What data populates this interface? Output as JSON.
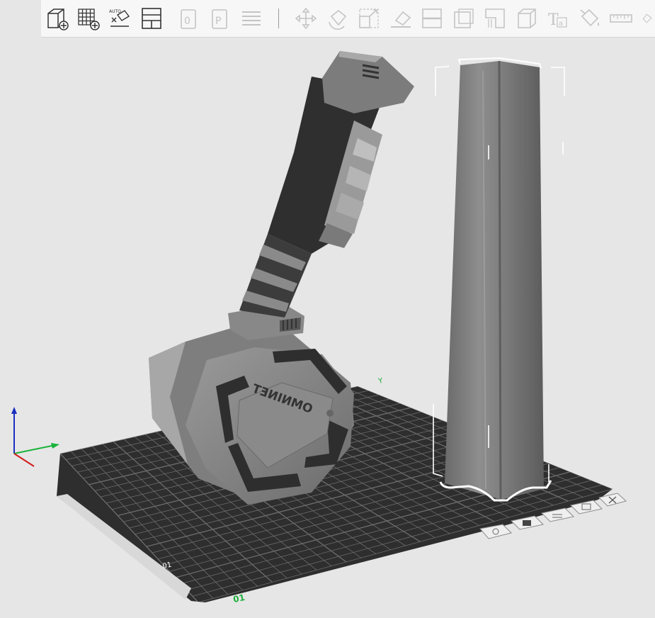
{
  "toolbar": {
    "tools": [
      {
        "name": "add-object-icon",
        "enabled": true
      },
      {
        "name": "add-grid-object-icon",
        "enabled": true
      },
      {
        "name": "auto-arrange-icon",
        "enabled": true,
        "label": "AUTO"
      },
      {
        "name": "layout-panels-icon",
        "enabled": true
      },
      {
        "name": "copy-object-icon",
        "enabled": false
      },
      {
        "name": "paste-object-icon",
        "enabled": false
      },
      {
        "name": "layers-icon",
        "enabled": false
      },
      {
        "name": "move-icon",
        "enabled": false
      },
      {
        "name": "rotate-icon",
        "enabled": false
      },
      {
        "name": "scale-icon",
        "enabled": false
      },
      {
        "name": "lay-flat-icon",
        "enabled": false
      },
      {
        "name": "cut-icon",
        "enabled": false
      },
      {
        "name": "hollow-icon",
        "enabled": false
      },
      {
        "name": "support-icon",
        "enabled": false
      },
      {
        "name": "primitive-cube-icon",
        "enabled": false
      },
      {
        "name": "text-icon",
        "enabled": false,
        "label": "Ta"
      },
      {
        "name": "paint-bucket-icon",
        "enabled": false
      },
      {
        "name": "measure-ruler-icon",
        "enabled": false
      },
      {
        "name": "more-tools-icon",
        "enabled": false
      }
    ]
  },
  "viewport": {
    "bed_label": "01",
    "stand_text": "OMNINET",
    "axis_y_label": "Y",
    "colors": {
      "background": "#e6e6e6",
      "bed": "#2f2f2f",
      "grid": "#6e6e6e",
      "model_light": "#8d8d8d",
      "model_dark": "#3b3b3b",
      "pillar": "#808080",
      "selection": "#ffffff",
      "axis_x": "#d11c1c",
      "axis_y": "#19b33a",
      "axis_z": "#1a2fbf"
    },
    "view_buttons": [
      "view-iso-icon",
      "view-front-icon",
      "view-side-icon",
      "view-top-icon",
      "view-close-icon"
    ]
  }
}
